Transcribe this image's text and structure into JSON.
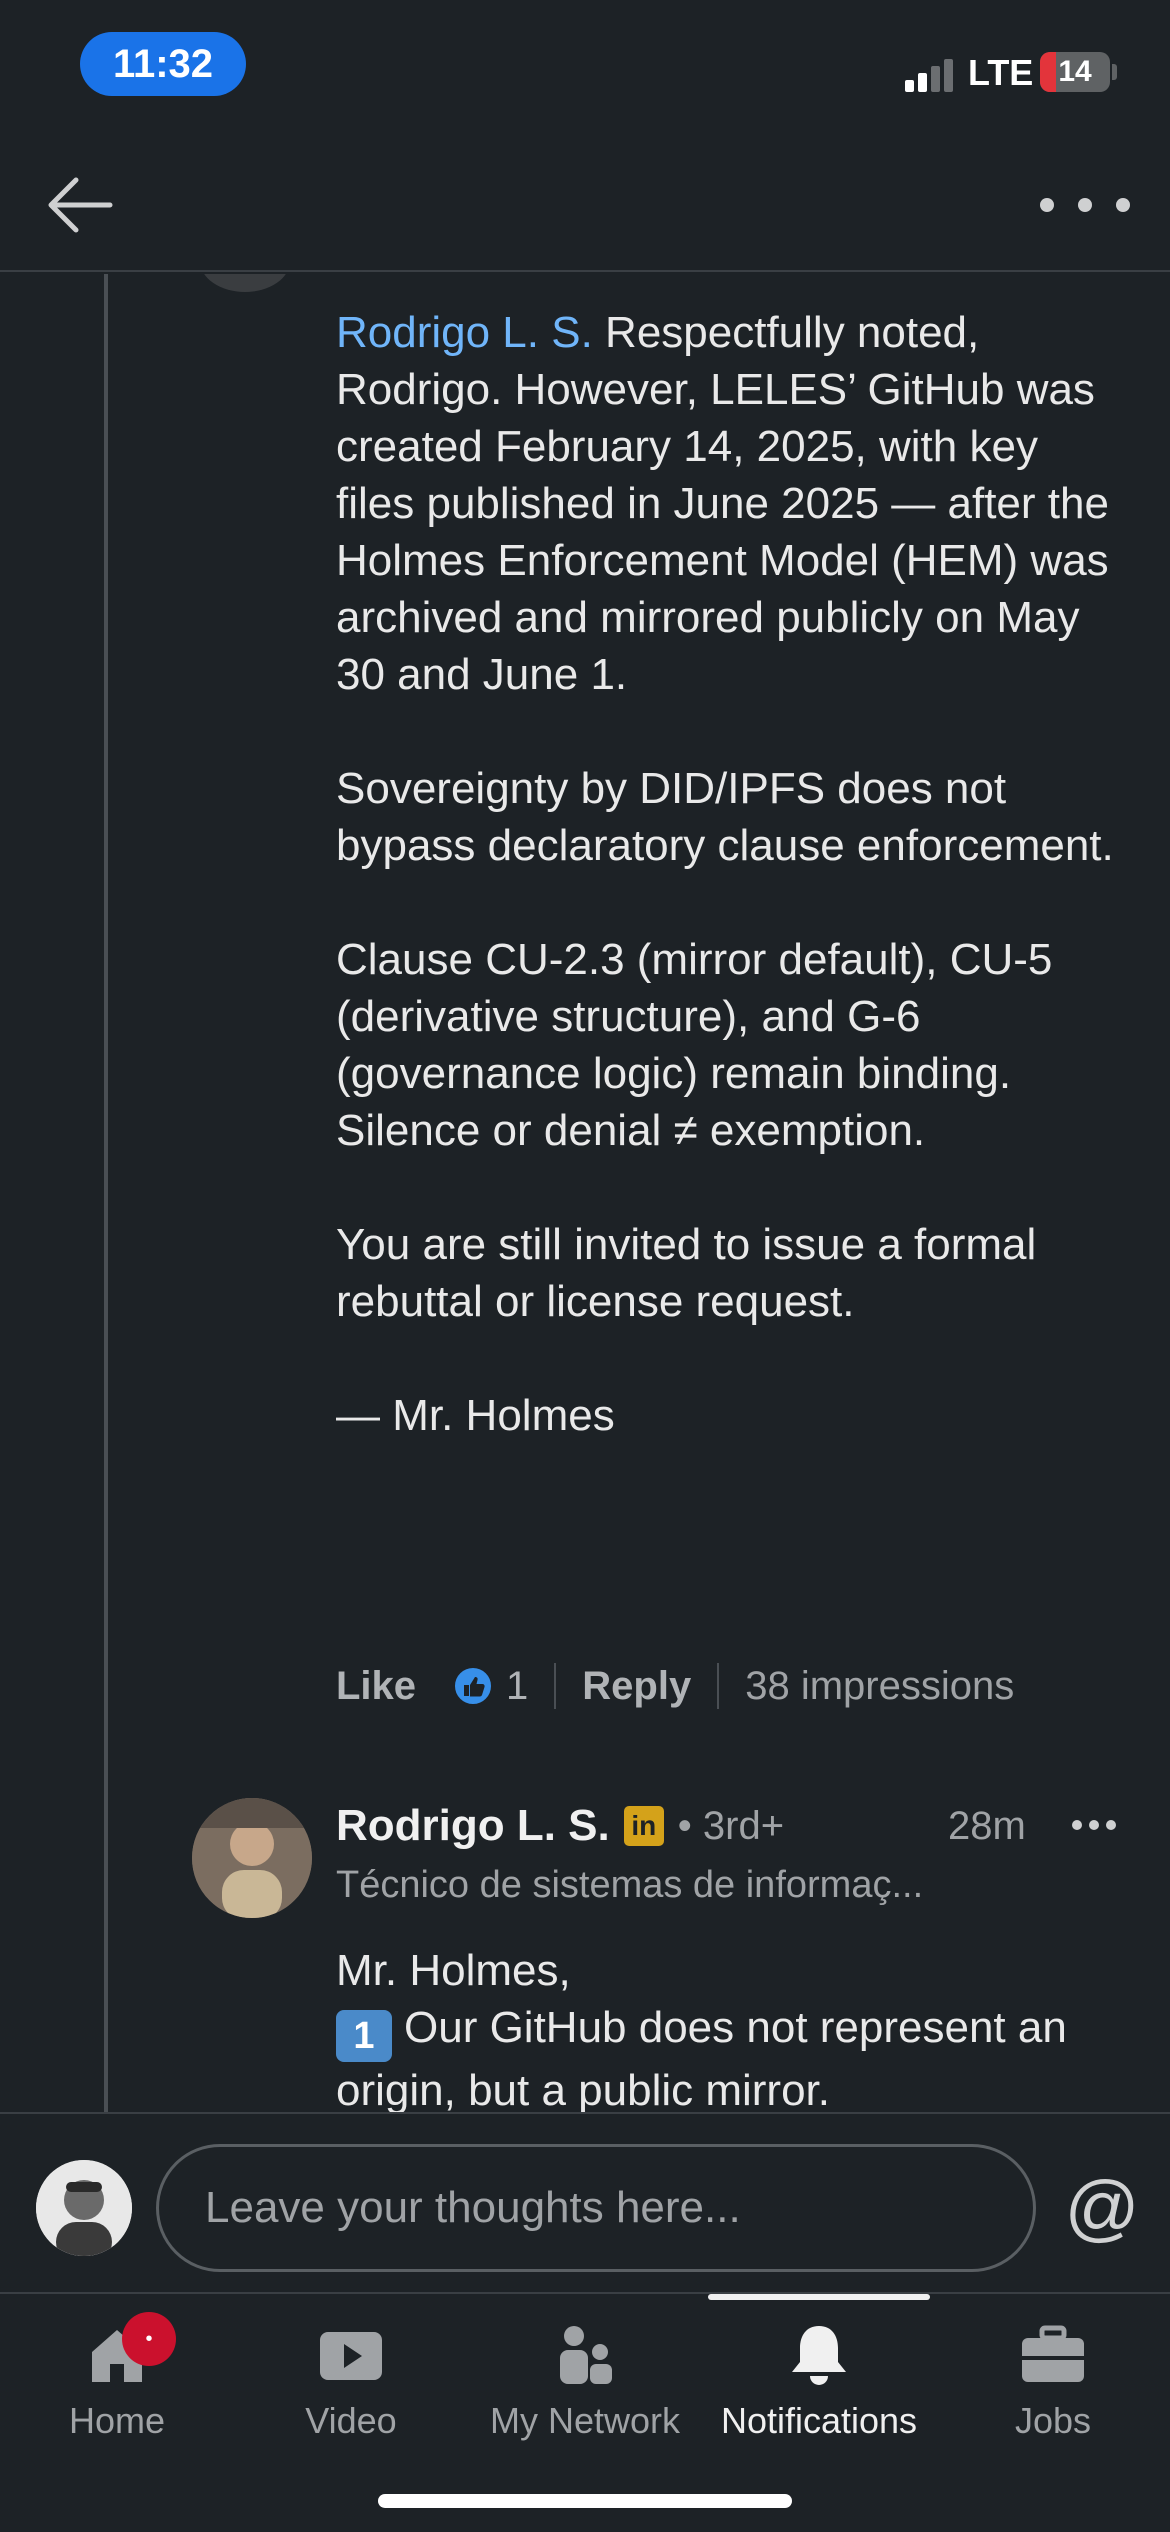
{
  "status_bar": {
    "time": "11:32",
    "network": "LTE",
    "battery": "14"
  },
  "header": {
    "back_icon": "arrow-left-icon",
    "more_icon": "more-horizontal-icon"
  },
  "comment": {
    "mention": "Rodrigo L. S.",
    "text": " Respectfully noted, Rodrigo. However, LELES’ GitHub was created February 14, 2025, with key files published in June 2025 — after the Holmes Enforcement Model (HEM) was archived and mirrored publicly on May 30 and June 1.\n\nSovereignty by DID/IPFS does not bypass declaratory clause enforcement.\n\nClause CU-2.3 (mirror default), CU-5 (derivative structure), and G-6 (governance logic) remain binding. Silence or denial ≠ exemption.\n\nYou are still invited to issue a formal rebuttal or license request.\n\n— Mr. Holmes",
    "like_label": "Like",
    "reaction_count": "1",
    "reply_label": "Reply",
    "impressions": "38 impressions"
  },
  "reply": {
    "author": "Rodrigo L. S.",
    "badge": "in",
    "degree": "• 3rd+",
    "time": "28m",
    "headline": "Técnico de sistemas de informaç...",
    "greeting": "Mr. Holmes,",
    "number_key": "1",
    "line1": "Our GitHub does not represent an origin, but a public mirror."
  },
  "composer": {
    "placeholder": "Leave your thoughts here...",
    "at_symbol": "@"
  },
  "bottom_nav": [
    {
      "label": "Home",
      "icon": "home-icon"
    },
    {
      "label": "Video",
      "icon": "video-icon"
    },
    {
      "label": "My Network",
      "icon": "network-icon"
    },
    {
      "label": "Notifications",
      "icon": "bell-icon",
      "active": true
    },
    {
      "label": "Jobs",
      "icon": "briefcase-icon"
    }
  ],
  "colors": {
    "background": "#1d2226",
    "mention": "#70b5f9",
    "accent_blue": "#1a73e8",
    "badge_red": "#cb112d"
  }
}
